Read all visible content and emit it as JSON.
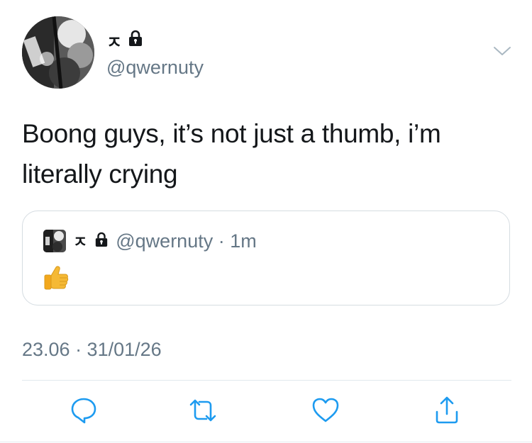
{
  "author": {
    "name": "ㅈ",
    "handle": "@qwernuty"
  },
  "tweet": {
    "text": "Boong guys, it’s not just a thumb, i’m literally crying"
  },
  "quoted": {
    "name": "ㅈ",
    "handle_time": "@qwernuty · 1m",
    "content_emoji": "thumbs-up"
  },
  "meta": {
    "timestamp": "23.06 · 31/01/26"
  },
  "icons": {
    "lock": "lock-icon",
    "menu": "chevron-down-icon",
    "reply": "reply-icon",
    "retweet": "retweet-icon",
    "like": "heart-icon",
    "share": "share-icon"
  },
  "colors": {
    "text": "#14171a",
    "muted": "#657786",
    "border": "#d5dce1",
    "icon": "#1d9bf0"
  }
}
